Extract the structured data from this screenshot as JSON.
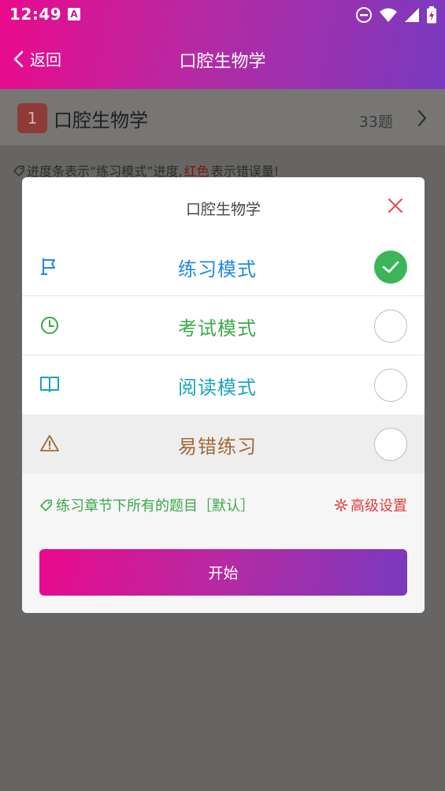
{
  "status_bar": {
    "time": "12:49",
    "badge": "A"
  },
  "app_bar": {
    "back_label": "返回",
    "title": "口腔生物学"
  },
  "chapter": {
    "number": "1",
    "name": "口腔生物学",
    "count": "33题"
  },
  "hint": {
    "prefix": "进度条表示“练习模式”进度,",
    "red": "红色",
    "suffix": "表示错误量!"
  },
  "modal": {
    "title": "口腔生物学",
    "modes": [
      {
        "label": "练习模式",
        "icon": "flag-icon",
        "color": "#1e88e5",
        "selected": true
      },
      {
        "label": "考试模式",
        "icon": "clock-icon",
        "color": "#3aa84a",
        "selected": false
      },
      {
        "label": "阅读模式",
        "icon": "book-icon",
        "color": "#1aa5b8",
        "selected": false
      },
      {
        "label": "易错练习",
        "icon": "warning-icon",
        "color": "#a0693a",
        "selected": false
      }
    ],
    "scope_label": "练习章节下所有的题目［默认］",
    "advanced_label": "高级设置",
    "start_label": "开始"
  },
  "colors": {
    "brand_start": "#ea0a8c",
    "brand_end": "#7a3abf",
    "check_green": "#3cb55a"
  }
}
